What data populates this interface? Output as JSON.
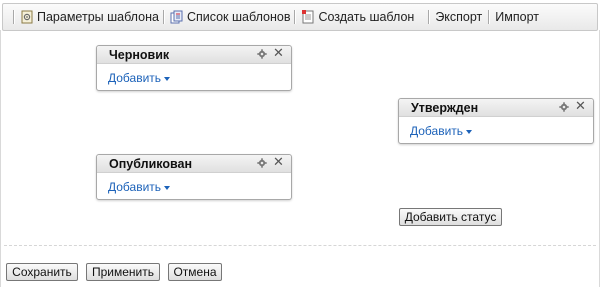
{
  "toolbar": {
    "items": [
      {
        "label": "Параметры шаблона",
        "icon": "template-settings-icon"
      },
      {
        "label": "Список шаблонов",
        "icon": "template-list-icon"
      },
      {
        "label": "Создать шаблон",
        "icon": "create-template-icon"
      },
      {
        "label": "Экспорт"
      },
      {
        "label": "Импорт"
      }
    ]
  },
  "statuses": [
    {
      "title": "Черновик",
      "add_label": "Добавить"
    },
    {
      "title": "Утвержден",
      "add_label": "Добавить"
    },
    {
      "title": "Опубликован",
      "add_label": "Добавить"
    }
  ],
  "add_status_label": "Добавить статус",
  "footer": {
    "save_label": "Сохранить",
    "apply_label": "Применить",
    "cancel_label": "Отмена"
  },
  "colors": {
    "link": "#1c62b9",
    "header_gradient_top": "#f4f4f4",
    "header_gradient_bottom": "#e0e0e0"
  }
}
